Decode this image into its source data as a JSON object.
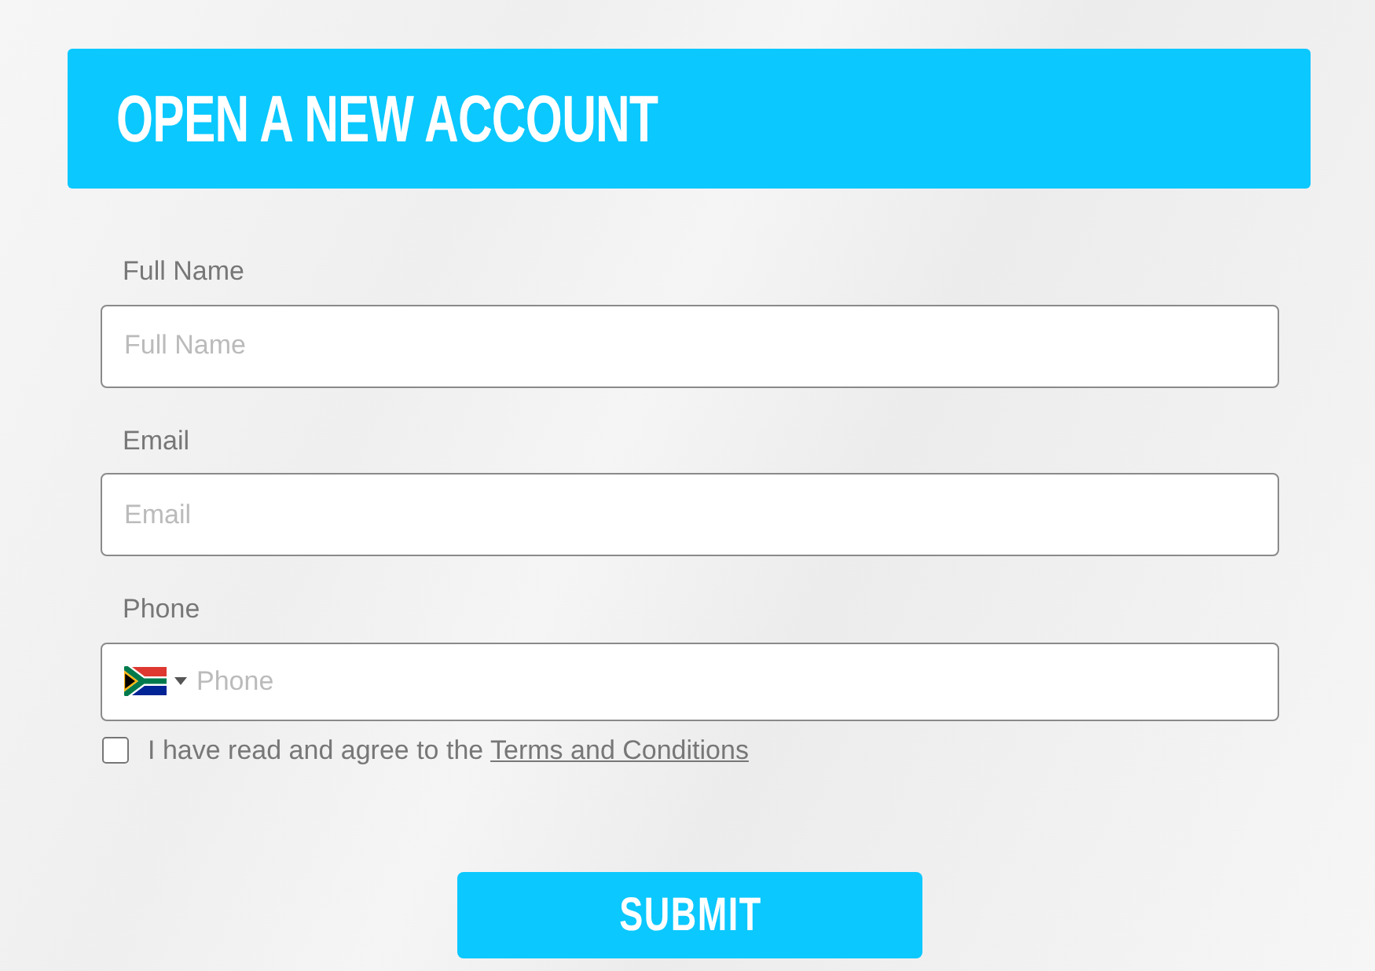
{
  "header": {
    "title": "OPEN A NEW ACCOUNT"
  },
  "fields": [
    {
      "kind": "text",
      "label": "Full Name",
      "placeholder": "Full Name"
    },
    {
      "kind": "text",
      "label": "Email",
      "placeholder": "Email"
    },
    {
      "kind": "phone",
      "label": "Phone",
      "placeholder": "Phone"
    }
  ],
  "agreement": {
    "checked": false,
    "text": "I have read and agree to the",
    "link": "Terms and Conditions"
  },
  "submit": {
    "label": "SUBMIT"
  }
}
